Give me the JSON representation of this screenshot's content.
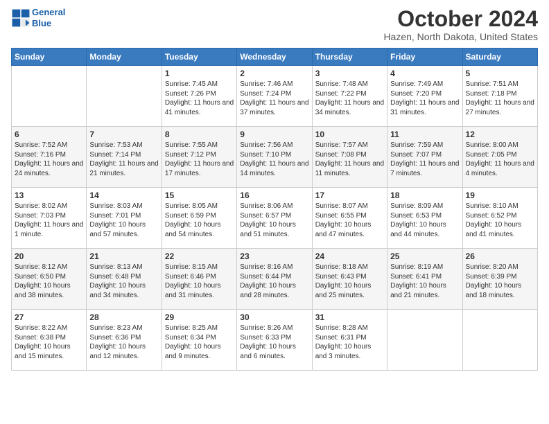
{
  "header": {
    "logo_line1": "General",
    "logo_line2": "Blue",
    "title": "October 2024",
    "subtitle": "Hazen, North Dakota, United States"
  },
  "days_of_week": [
    "Sunday",
    "Monday",
    "Tuesday",
    "Wednesday",
    "Thursday",
    "Friday",
    "Saturday"
  ],
  "weeks": [
    [
      {
        "num": "",
        "info": ""
      },
      {
        "num": "",
        "info": ""
      },
      {
        "num": "1",
        "info": "Sunrise: 7:45 AM\nSunset: 7:26 PM\nDaylight: 11 hours and 41 minutes."
      },
      {
        "num": "2",
        "info": "Sunrise: 7:46 AM\nSunset: 7:24 PM\nDaylight: 11 hours and 37 minutes."
      },
      {
        "num": "3",
        "info": "Sunrise: 7:48 AM\nSunset: 7:22 PM\nDaylight: 11 hours and 34 minutes."
      },
      {
        "num": "4",
        "info": "Sunrise: 7:49 AM\nSunset: 7:20 PM\nDaylight: 11 hours and 31 minutes."
      },
      {
        "num": "5",
        "info": "Sunrise: 7:51 AM\nSunset: 7:18 PM\nDaylight: 11 hours and 27 minutes."
      }
    ],
    [
      {
        "num": "6",
        "info": "Sunrise: 7:52 AM\nSunset: 7:16 PM\nDaylight: 11 hours and 24 minutes."
      },
      {
        "num": "7",
        "info": "Sunrise: 7:53 AM\nSunset: 7:14 PM\nDaylight: 11 hours and 21 minutes."
      },
      {
        "num": "8",
        "info": "Sunrise: 7:55 AM\nSunset: 7:12 PM\nDaylight: 11 hours and 17 minutes."
      },
      {
        "num": "9",
        "info": "Sunrise: 7:56 AM\nSunset: 7:10 PM\nDaylight: 11 hours and 14 minutes."
      },
      {
        "num": "10",
        "info": "Sunrise: 7:57 AM\nSunset: 7:08 PM\nDaylight: 11 hours and 11 minutes."
      },
      {
        "num": "11",
        "info": "Sunrise: 7:59 AM\nSunset: 7:07 PM\nDaylight: 11 hours and 7 minutes."
      },
      {
        "num": "12",
        "info": "Sunrise: 8:00 AM\nSunset: 7:05 PM\nDaylight: 11 hours and 4 minutes."
      }
    ],
    [
      {
        "num": "13",
        "info": "Sunrise: 8:02 AM\nSunset: 7:03 PM\nDaylight: 11 hours and 1 minute."
      },
      {
        "num": "14",
        "info": "Sunrise: 8:03 AM\nSunset: 7:01 PM\nDaylight: 10 hours and 57 minutes."
      },
      {
        "num": "15",
        "info": "Sunrise: 8:05 AM\nSunset: 6:59 PM\nDaylight: 10 hours and 54 minutes."
      },
      {
        "num": "16",
        "info": "Sunrise: 8:06 AM\nSunset: 6:57 PM\nDaylight: 10 hours and 51 minutes."
      },
      {
        "num": "17",
        "info": "Sunrise: 8:07 AM\nSunset: 6:55 PM\nDaylight: 10 hours and 47 minutes."
      },
      {
        "num": "18",
        "info": "Sunrise: 8:09 AM\nSunset: 6:53 PM\nDaylight: 10 hours and 44 minutes."
      },
      {
        "num": "19",
        "info": "Sunrise: 8:10 AM\nSunset: 6:52 PM\nDaylight: 10 hours and 41 minutes."
      }
    ],
    [
      {
        "num": "20",
        "info": "Sunrise: 8:12 AM\nSunset: 6:50 PM\nDaylight: 10 hours and 38 minutes."
      },
      {
        "num": "21",
        "info": "Sunrise: 8:13 AM\nSunset: 6:48 PM\nDaylight: 10 hours and 34 minutes."
      },
      {
        "num": "22",
        "info": "Sunrise: 8:15 AM\nSunset: 6:46 PM\nDaylight: 10 hours and 31 minutes."
      },
      {
        "num": "23",
        "info": "Sunrise: 8:16 AM\nSunset: 6:44 PM\nDaylight: 10 hours and 28 minutes."
      },
      {
        "num": "24",
        "info": "Sunrise: 8:18 AM\nSunset: 6:43 PM\nDaylight: 10 hours and 25 minutes."
      },
      {
        "num": "25",
        "info": "Sunrise: 8:19 AM\nSunset: 6:41 PM\nDaylight: 10 hours and 21 minutes."
      },
      {
        "num": "26",
        "info": "Sunrise: 8:20 AM\nSunset: 6:39 PM\nDaylight: 10 hours and 18 minutes."
      }
    ],
    [
      {
        "num": "27",
        "info": "Sunrise: 8:22 AM\nSunset: 6:38 PM\nDaylight: 10 hours and 15 minutes."
      },
      {
        "num": "28",
        "info": "Sunrise: 8:23 AM\nSunset: 6:36 PM\nDaylight: 10 hours and 12 minutes."
      },
      {
        "num": "29",
        "info": "Sunrise: 8:25 AM\nSunset: 6:34 PM\nDaylight: 10 hours and 9 minutes."
      },
      {
        "num": "30",
        "info": "Sunrise: 8:26 AM\nSunset: 6:33 PM\nDaylight: 10 hours and 6 minutes."
      },
      {
        "num": "31",
        "info": "Sunrise: 8:28 AM\nSunset: 6:31 PM\nDaylight: 10 hours and 3 minutes."
      },
      {
        "num": "",
        "info": ""
      },
      {
        "num": "",
        "info": ""
      }
    ]
  ]
}
